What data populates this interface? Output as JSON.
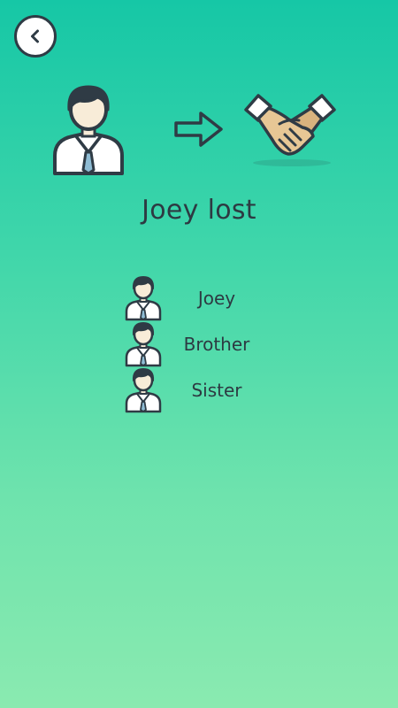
{
  "header": {
    "back_icon": "chevron-left-icon"
  },
  "hero": {
    "from_icon": "person-icon",
    "arrow_icon": "arrow-right-icon",
    "to_icon": "handshake-icon"
  },
  "result": {
    "title": "Joey lost"
  },
  "players": [
    {
      "name": "Joey",
      "icon": "person-icon"
    },
    {
      "name": "Brother",
      "icon": "person-icon"
    },
    {
      "name": "Sister",
      "icon": "person-icon"
    }
  ],
  "colors": {
    "background_top": "#16c7a6",
    "background_bottom": "#8aeab0",
    "outline": "#2f3b45",
    "skin": "#f8ecd8",
    "tie": "#8fbcd4",
    "hand": "#e7c795"
  }
}
